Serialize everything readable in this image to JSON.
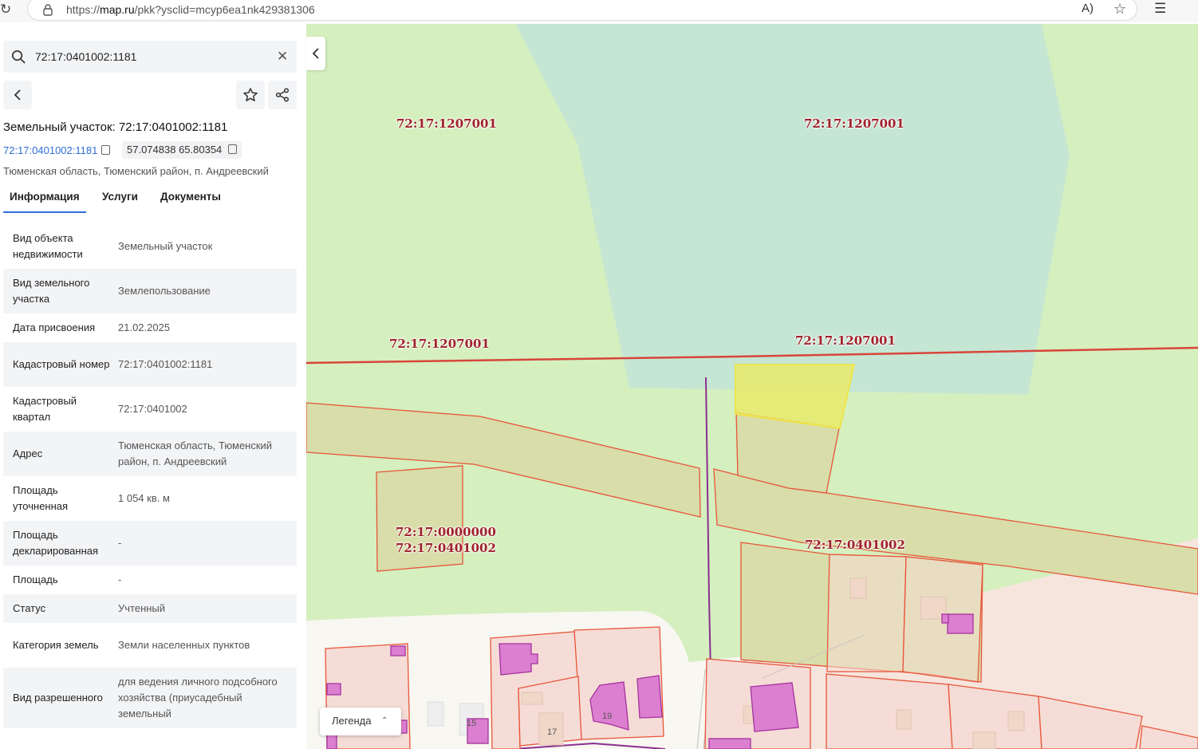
{
  "browser": {
    "url_prefix": "https://",
    "url_host": "map.ru",
    "url_path": "/pkk?ysclid=mcyp6ea1nk429381306",
    "read_aloud": "A)"
  },
  "search": {
    "value": "72:17:0401002:1181"
  },
  "object": {
    "title": "Земельный участок: 72:17:0401002:1181",
    "cad_link": "72:17:0401002:1181",
    "coords": "57.074838 65.80354",
    "address": "Тюменская область, Тюменский район, п. Андреевский"
  },
  "tabs": [
    "Информация",
    "Услуги",
    "Документы"
  ],
  "props": [
    {
      "k": "Вид объекта недвижимости",
      "v": "Земельный участок"
    },
    {
      "k": "Вид земельного участка",
      "v": "Землепользование"
    },
    {
      "k": "Дата присвоения",
      "v": "21.02.2025"
    },
    {
      "k": "Кадастровый номер",
      "v": "72:17:0401002:1181"
    },
    {
      "k": "Кадастровый квартал",
      "v": "72:17:0401002"
    },
    {
      "k": "Адрес",
      "v": "Тюменская область, Тюменский район, п. Андреевский"
    },
    {
      "k": "Площадь уточненная",
      "v": "1 054 кв. м"
    },
    {
      "k": "Площадь декларированная",
      "v": "-"
    },
    {
      "k": "Площадь",
      "v": "-"
    },
    {
      "k": "Статус",
      "v": "Учтенный"
    },
    {
      "k": "Категория земель",
      "v": "Земли населенных пунктов"
    },
    {
      "k": "Вид разрешенного",
      "v": "для ведения личного подсобного хозяйства (приусадебный земельный"
    }
  ],
  "legend": {
    "label": "Легенда"
  },
  "map": {
    "labels": [
      "72:17:1207001",
      "72:17:1207001",
      "72:17:1207001",
      "72:17:1207001",
      "72:17:0000000",
      "72:17:0401002",
      "72:17:0401002"
    ],
    "house_numbers": [
      "15",
      "17",
      "19"
    ]
  },
  "colors": {
    "accent": "#2e6fd8",
    "map_label": "#a0202a",
    "parcel_border": "#e8553a",
    "selected_parcel": "#e9ea6a",
    "building": "#dc7fd0"
  }
}
